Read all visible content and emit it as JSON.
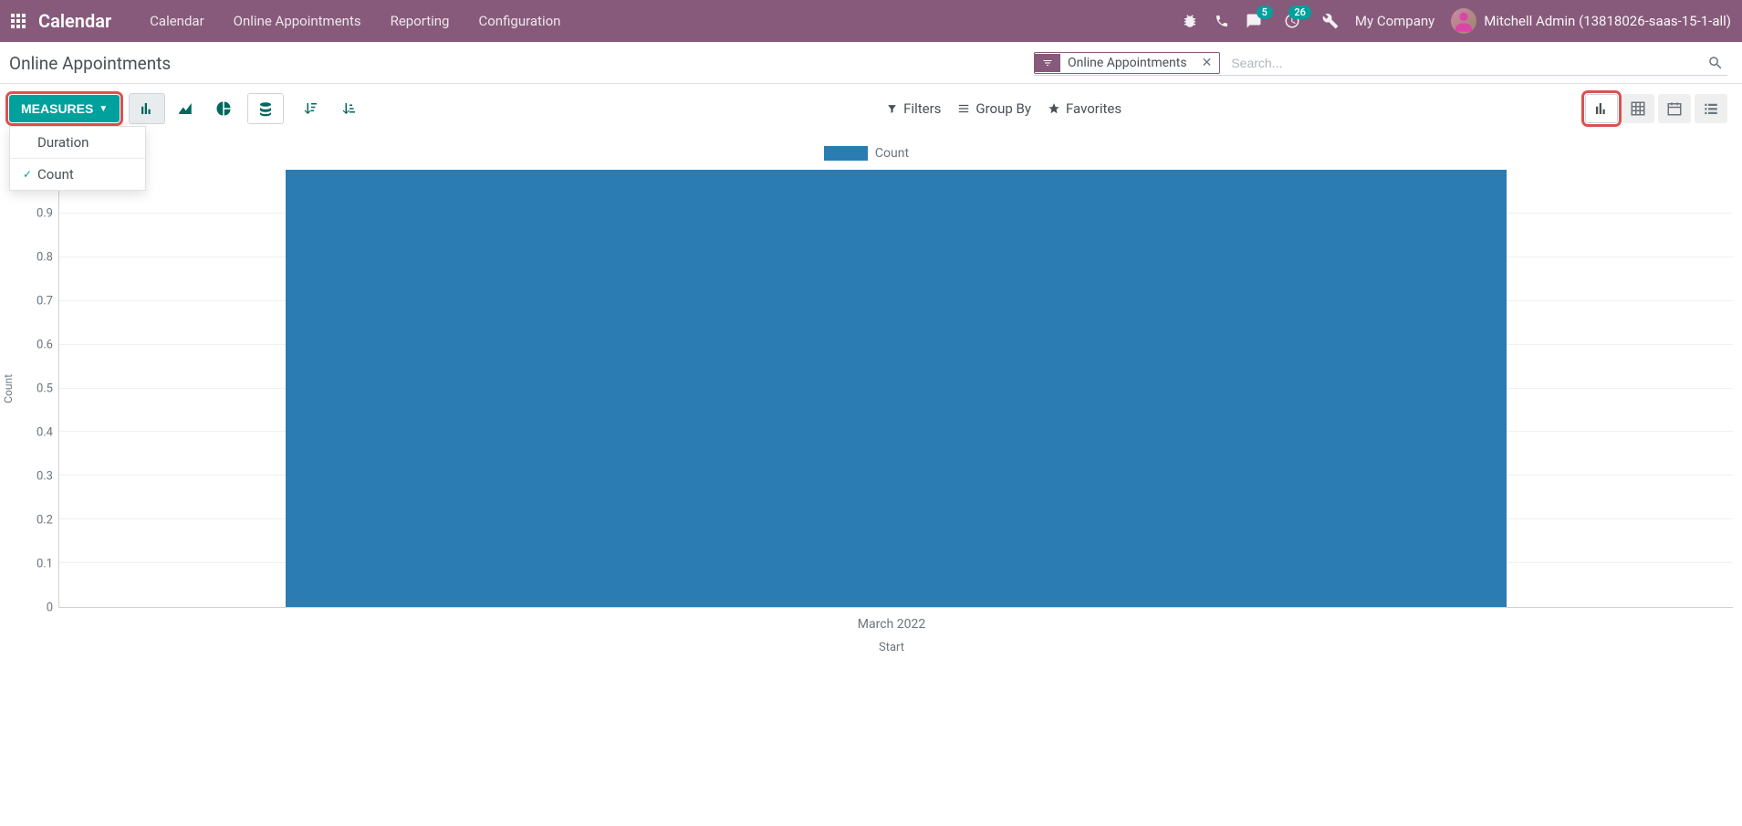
{
  "navbar": {
    "brand": "Calendar",
    "links": [
      "Calendar",
      "Online Appointments",
      "Reporting",
      "Configuration"
    ],
    "messages_badge": "5",
    "activities_badge": "26",
    "company": "My Company",
    "user": "Mitchell Admin (13818026-saas-15-1-all)"
  },
  "breadcrumb": "Online Appointments",
  "search": {
    "facet_label": "Online Appointments",
    "placeholder": "Search..."
  },
  "toolbar": {
    "measures_label": "MEASURES",
    "filters_label": "Filters",
    "groupby_label": "Group By",
    "favorites_label": "Favorites"
  },
  "measures_dropdown": {
    "items": [
      {
        "label": "Duration",
        "checked": false
      },
      {
        "label": "Count",
        "checked": true
      }
    ]
  },
  "chart_data": {
    "type": "bar",
    "title": "",
    "xlabel": "Start",
    "ylabel": "Count",
    "categories": [
      "March 2022"
    ],
    "values": [
      1
    ],
    "ylim": [
      0,
      1
    ],
    "yticks": [
      0,
      0.1,
      0.2,
      0.3,
      0.4,
      0.5,
      0.6,
      0.7,
      0.8,
      0.9
    ],
    "legend": [
      {
        "name": "Count",
        "color": "#2b7cb3"
      }
    ]
  }
}
